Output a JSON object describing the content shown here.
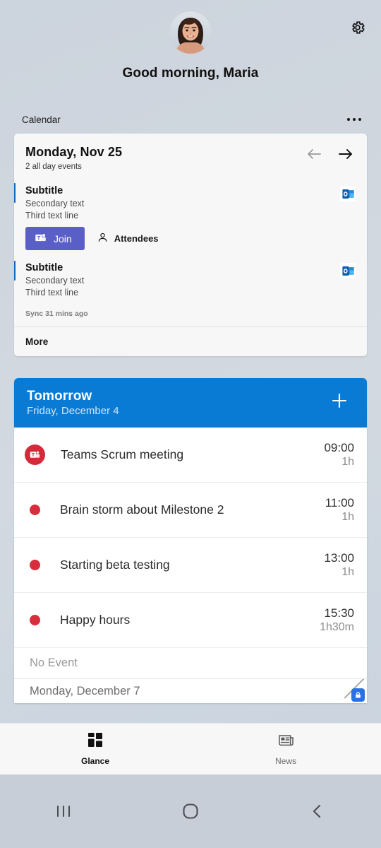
{
  "header": {
    "greeting": "Good morning, Maria",
    "avatar_icon": "user-avatar-photo",
    "settings_icon": "gear-icon"
  },
  "section": {
    "label": "Calendar",
    "overflow_icon": "ellipsis-icon"
  },
  "calendar_card": {
    "date_title": "Monday, Nov 25",
    "all_day_summary": "2 all day events",
    "prev_icon": "arrow-left-icon",
    "next_icon": "arrow-right-icon",
    "events": [
      {
        "title": "Subtitle",
        "secondary": "Secondary text",
        "third": "Third text line",
        "source_icon": "outlook-icon",
        "join_label": "Join",
        "join_icon": "teams-icon",
        "attendees_label": "Attendees",
        "attendees_icon": "person-icon"
      },
      {
        "title": "Subtitle",
        "secondary": "Secondary text",
        "third": "Third text line",
        "source_icon": "outlook-icon"
      }
    ],
    "sync_status": "Sync 31 mins ago",
    "more_label": "More",
    "accent_color": "#1668c1",
    "join_color": "#5a5fc7"
  },
  "tomorrow_card": {
    "title": "Tomorrow",
    "subtitle": "Friday, December 4",
    "add_icon": "plus-icon",
    "header_color": "#0a7bd4",
    "events": [
      {
        "title": "Teams Scrum meeting",
        "time": "09:00",
        "duration": "1h",
        "icon": "teams-circle-icon"
      },
      {
        "title": "Brain storm about Milestone 2",
        "time": "11:00",
        "duration": "1h",
        "icon": "red-dot-icon"
      },
      {
        "title": "Starting beta testing",
        "time": "13:00",
        "duration": "1h",
        "icon": "red-dot-icon"
      },
      {
        "title": "Happy hours",
        "time": "15:30",
        "duration": "1h30m",
        "icon": "red-dot-icon"
      }
    ],
    "no_event_label": "No Event",
    "next_day_label": "Monday, December 7",
    "badge_icon": "lock-badge-icon",
    "resize_icon": "resize-handle-icon"
  },
  "bottom_nav": {
    "tabs": [
      {
        "label": "Glance",
        "icon": "grid-icon",
        "active": true
      },
      {
        "label": "News",
        "icon": "newspaper-icon",
        "active": false
      }
    ]
  },
  "system_nav": {
    "recents_icon": "recents-icon",
    "home_icon": "home-icon",
    "back_icon": "back-icon"
  }
}
